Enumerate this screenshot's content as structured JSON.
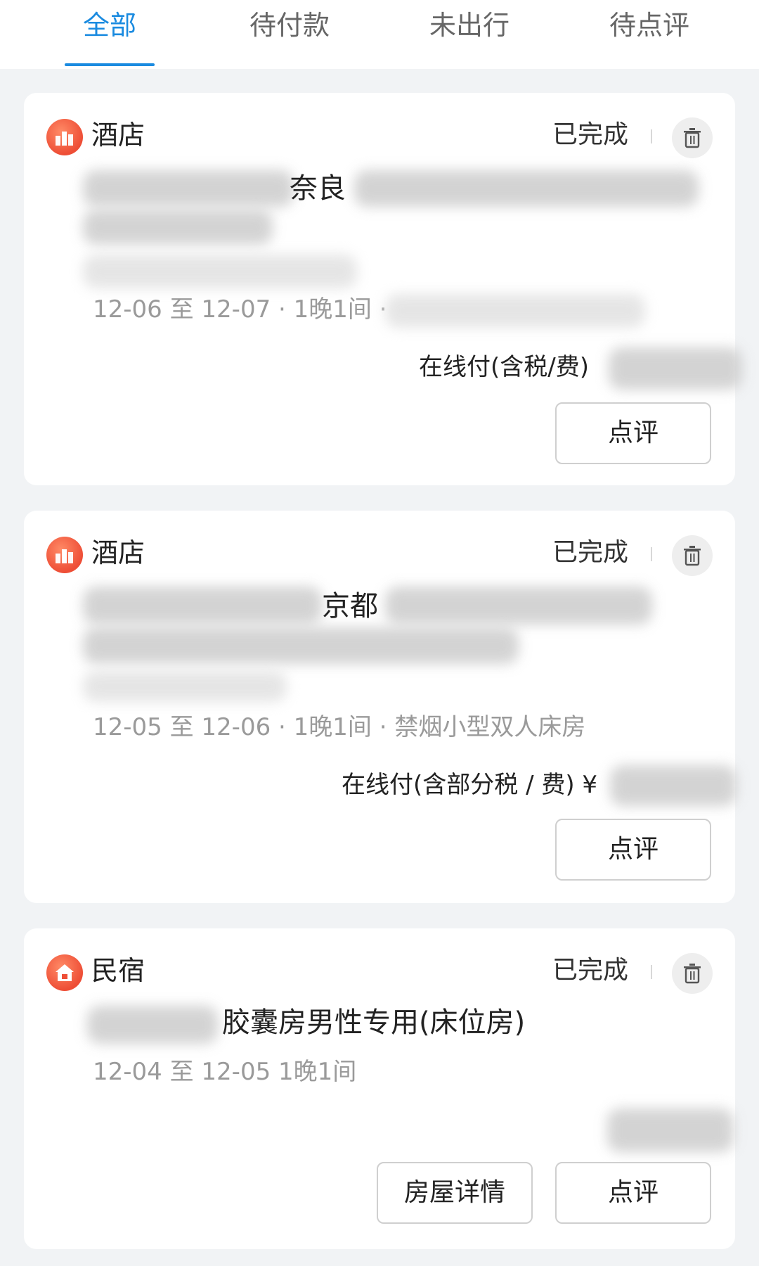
{
  "tabs": [
    {
      "label": "全部"
    },
    {
      "label": "待付款"
    },
    {
      "label": "未出行"
    },
    {
      "label": "待点评"
    }
  ],
  "colors": {
    "accent": "#1b8be0",
    "icon": "#ee4e36"
  },
  "orders": [
    {
      "type_label": "酒店",
      "icon": "hotel-icon",
      "status": "已完成",
      "name_visible": "奈良",
      "meta_visible": "12-06 至 12-07 · 1晚1间 ·",
      "price_label": "在线付(含税/费)",
      "buttons": [
        "点评"
      ]
    },
    {
      "type_label": "酒店",
      "icon": "hotel-icon",
      "status": "已完成",
      "name_visible": "京都",
      "meta_visible": "12-05 至 12-06 · 1晚1间 · 禁烟小型双人床房",
      "price_label": "在线付(含部分税 / 费) ¥",
      "buttons": [
        "点评"
      ]
    },
    {
      "type_label": "民宿",
      "icon": "homestay-icon",
      "status": "已完成",
      "name_visible": "胶囊房男性专用(床位房)",
      "meta_visible": "12-04 至 12-05 1晚1间",
      "buttons": [
        "房屋详情",
        "点评"
      ]
    }
  ]
}
